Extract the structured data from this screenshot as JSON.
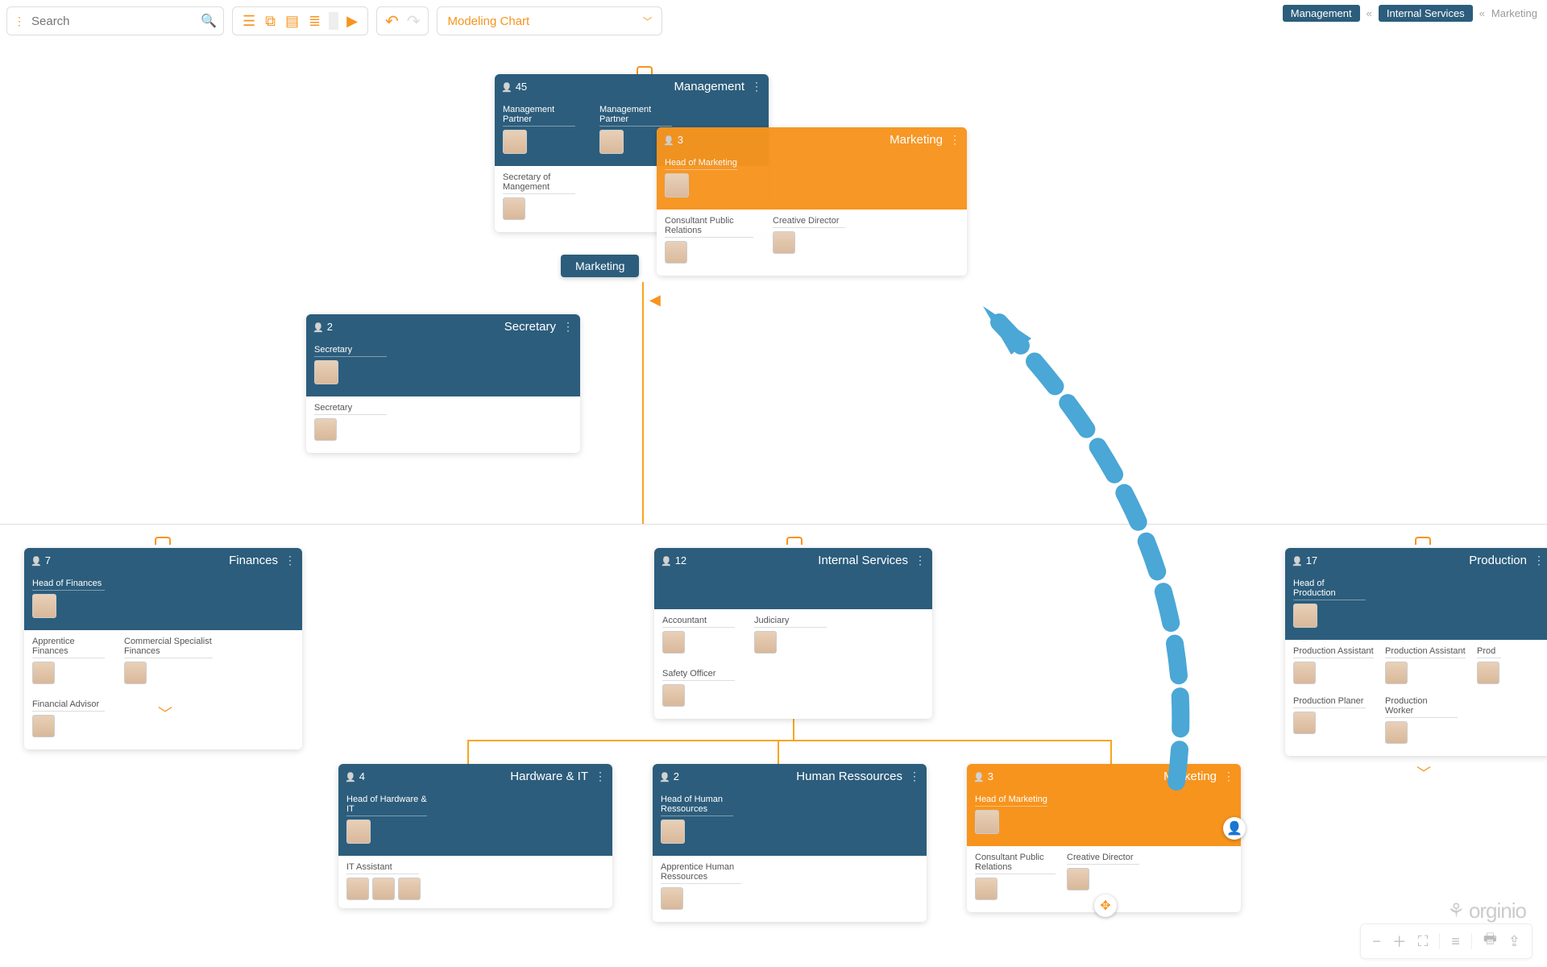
{
  "search": {
    "placeholder": "Search"
  },
  "view_selector": {
    "label": "Modeling Chart"
  },
  "breadcrumb": {
    "items": [
      "Management",
      "Internal Services"
    ],
    "current": "Marketing",
    "separator": "«"
  },
  "cards": {
    "management": {
      "count": "45",
      "title": "Management",
      "leads": [
        {
          "role": "Management Partner"
        },
        {
          "role": "Management Partner"
        }
      ],
      "members": [
        {
          "role": "Secretary of Mangement"
        }
      ]
    },
    "marketing_drag": {
      "count": "3",
      "title": "Marketing",
      "lead": {
        "role": "Head of Marketing"
      },
      "members": [
        {
          "role": "Consultant Public Relations"
        },
        {
          "role": "Creative Director"
        }
      ]
    },
    "marketing_tag": {
      "label": "Marketing"
    },
    "secretary": {
      "count": "2",
      "title": "Secretary",
      "lead": {
        "role": "Secretary"
      },
      "members": [
        {
          "role": "Secretary"
        }
      ]
    },
    "finances": {
      "count": "7",
      "title": "Finances",
      "lead": {
        "role": "Head of Finances"
      },
      "members": [
        {
          "role": "Apprentice Finances"
        },
        {
          "role": "Commercial Specialist Finances"
        },
        {
          "role": "Financial Advisor"
        }
      ]
    },
    "internal": {
      "count": "12",
      "title": "Internal Services",
      "members": [
        {
          "role": "Accountant"
        },
        {
          "role": "Judiciary"
        },
        {
          "role": "Safety Officer"
        }
      ]
    },
    "production": {
      "count": "17",
      "title": "Production",
      "lead": {
        "role": "Head of Production"
      },
      "members": [
        {
          "role": "Production Assistant"
        },
        {
          "role": "Production Assistant"
        },
        {
          "role": "Prod"
        },
        {
          "role": "Production Planer"
        },
        {
          "role": "Production Worker"
        }
      ]
    },
    "hardware": {
      "count": "4",
      "title": "Hardware & IT",
      "lead": {
        "role": "Head of Hardware & IT"
      },
      "members": [
        {
          "role": "IT Assistant"
        }
      ]
    },
    "hr": {
      "count": "2",
      "title": "Human Ressources",
      "lead": {
        "role": "Head of Human Ressources"
      },
      "members": [
        {
          "role": "Apprentice Human Ressources"
        }
      ]
    },
    "marketing_bottom": {
      "count": "3",
      "title": "Marketing",
      "lead": {
        "role": "Head of Marketing"
      },
      "members": [
        {
          "role": "Consultant Public Relations"
        },
        {
          "role": "Creative Director"
        }
      ]
    }
  },
  "brand": "orginio"
}
